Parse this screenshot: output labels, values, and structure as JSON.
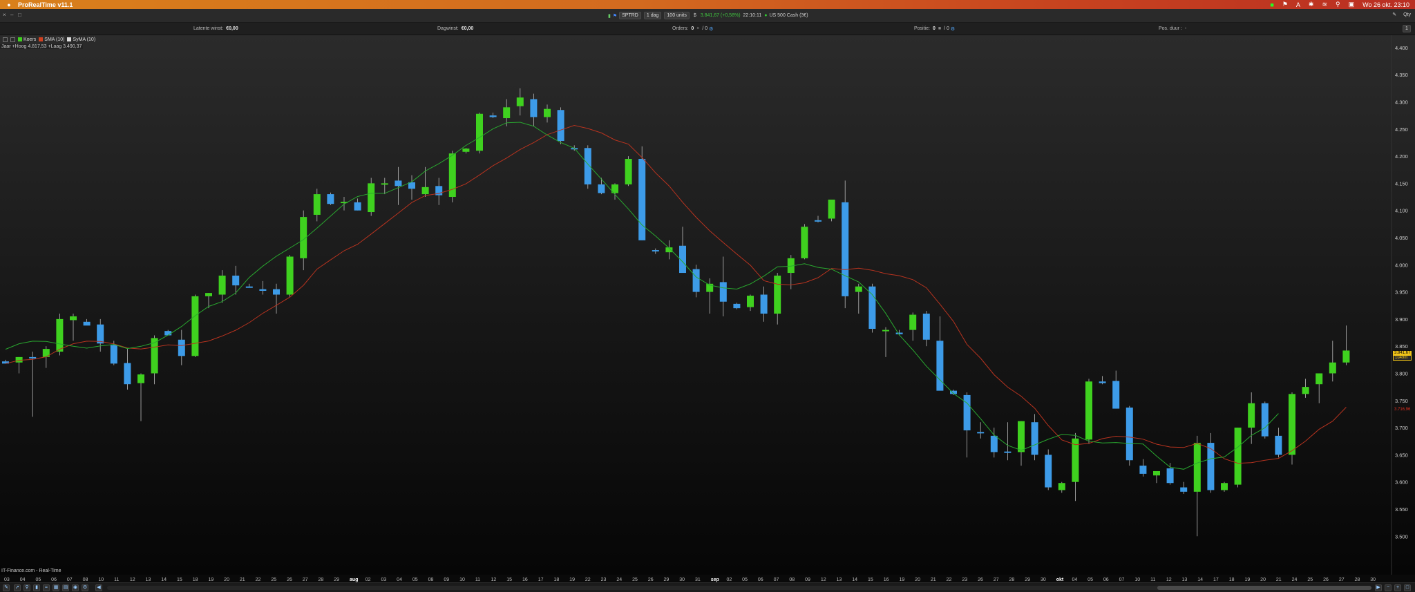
{
  "menubar": {
    "app_name": "ProRealTime v11.1",
    "clock": "Wo 26 okt. 23:10"
  },
  "toolbar": {
    "symbol": "SPTRD",
    "timeframe": "1 dag",
    "quantity": "100 units",
    "currency": "$",
    "price_change": "3.841,67 (+0,58%)",
    "time": "22:10:11",
    "instrument_name": "US 500 Cash (3€)"
  },
  "stats": {
    "latent_label": "Latente winst:",
    "latent_value": "€0,00",
    "daywin_label": "Dagwinst:",
    "daywin_value": "€0,00",
    "orders_label": "Orders:",
    "orders_value": "0",
    "orders_value2": "/ 0",
    "position_label": "Positie:",
    "position_value": "0",
    "position_value2": "/ 0",
    "posduur_label": "Pos. duur :",
    "posduur_value": "-"
  },
  "qty": {
    "label": "Qty",
    "value": "1"
  },
  "legend": {
    "koers": "Koers",
    "sma": "SMA (10)",
    "syma": "SyMA (10)"
  },
  "hilo_text": "Jaar +Hoog 4.817,53 +Laag 3.490,37",
  "footer_source": "IT-Finance.com - Real-Time",
  "price_badges": {
    "last": "3.841,67",
    "timer": "1u49m",
    "red": "3.716,96"
  },
  "colors": {
    "up": "#3fd11f",
    "down": "#3d9be8",
    "sma": "#b8331f",
    "syma": "#29a82f",
    "menubar": "#d36a1f"
  },
  "chart_data": {
    "type": "candlestick",
    "title": "",
    "ylim": [
      3480,
      4410
    ],
    "y_ticks": [
      "4.400",
      "4.350",
      "4.300",
      "4.250",
      "4.200",
      "4.150",
      "4.100",
      "4.050",
      "4.000",
      "3.950",
      "3.900",
      "3.850",
      "3.800",
      "3.750",
      "3.700",
      "3.650",
      "3.600",
      "3.550",
      "3.500"
    ],
    "x_labels": [
      "03",
      "04",
      "05",
      "06",
      "07",
      "08",
      "10",
      "11",
      "12",
      "13",
      "14",
      "15",
      "18",
      "19",
      "20",
      "21",
      "22",
      "25",
      "26",
      "27",
      "28",
      "29",
      "aug",
      "02",
      "03",
      "04",
      "05",
      "08",
      "09",
      "10",
      "11",
      "12",
      "15",
      "16",
      "17",
      "18",
      "19",
      "22",
      "23",
      "24",
      "25",
      "26",
      "29",
      "30",
      "31",
      "sep",
      "02",
      "05",
      "06",
      "07",
      "08",
      "09",
      "12",
      "13",
      "14",
      "15",
      "16",
      "19",
      "20",
      "21",
      "22",
      "23",
      "26",
      "27",
      "28",
      "29",
      "30",
      "okt",
      "04",
      "05",
      "06",
      "07",
      "10",
      "11",
      "12",
      "13",
      "14",
      "17",
      "18",
      "19",
      "20",
      "21",
      "24",
      "25",
      "26",
      "27",
      "28",
      "30"
    ],
    "month_labels": [
      "aug",
      "sep",
      "okt"
    ],
    "candles": [
      {
        "o": 3822,
        "h": 3825,
        "l": 3818,
        "c": 3818
      },
      {
        "o": 3820,
        "h": 3830,
        "l": 3800,
        "c": 3830
      },
      {
        "o": 3830,
        "h": 3840,
        "l": 3720,
        "c": 3829
      },
      {
        "o": 3830,
        "h": 3850,
        "l": 3810,
        "c": 3845
      },
      {
        "o": 3840,
        "h": 3910,
        "l": 3833,
        "c": 3900
      },
      {
        "o": 3898,
        "h": 3910,
        "l": 3860,
        "c": 3905
      },
      {
        "o": 3895,
        "h": 3900,
        "l": 3890,
        "c": 3888
      },
      {
        "o": 3890,
        "h": 3900,
        "l": 3840,
        "c": 3855
      },
      {
        "o": 3852,
        "h": 3860,
        "l": 3815,
        "c": 3818
      },
      {
        "o": 3819,
        "h": 3845,
        "l": 3770,
        "c": 3780
      },
      {
        "o": 3782,
        "h": 3800,
        "l": 3712,
        "c": 3798
      },
      {
        "o": 3800,
        "h": 3870,
        "l": 3780,
        "c": 3865
      },
      {
        "o": 3878,
        "h": 3880,
        "l": 3870,
        "c": 3870
      },
      {
        "o": 3862,
        "h": 3880,
        "l": 3815,
        "c": 3832
      },
      {
        "o": 3832,
        "h": 3945,
        "l": 3830,
        "c": 3942
      },
      {
        "o": 3942,
        "h": 3948,
        "l": 3920,
        "c": 3948
      },
      {
        "o": 3945,
        "h": 3990,
        "l": 3930,
        "c": 3980
      },
      {
        "o": 3980,
        "h": 3998,
        "l": 3945,
        "c": 3962
      },
      {
        "o": 3960,
        "h": 3965,
        "l": 3958,
        "c": 3958
      },
      {
        "o": 3955,
        "h": 3970,
        "l": 3945,
        "c": 3952
      },
      {
        "o": 3955,
        "h": 3965,
        "l": 3910,
        "c": 3945
      },
      {
        "o": 3945,
        "h": 4018,
        "l": 3940,
        "c": 4015
      },
      {
        "o": 4012,
        "h": 4100,
        "l": 3990,
        "c": 4088
      },
      {
        "o": 4092,
        "h": 4140,
        "l": 4080,
        "c": 4130
      },
      {
        "o": 4130,
        "h": 4133,
        "l": 4110,
        "c": 4112
      },
      {
        "o": 4115,
        "h": 4125,
        "l": 4100,
        "c": 4116
      },
      {
        "o": 4115,
        "h": 4122,
        "l": 4100,
        "c": 4100
      },
      {
        "o": 4097,
        "h": 4160,
        "l": 4090,
        "c": 4150
      },
      {
        "o": 4150,
        "h": 4160,
        "l": 4130,
        "c": 4150
      },
      {
        "o": 4155,
        "h": 4180,
        "l": 4110,
        "c": 4145
      },
      {
        "o": 4152,
        "h": 4165,
        "l": 4120,
        "c": 4140
      },
      {
        "o": 4130,
        "h": 4180,
        "l": 4125,
        "c": 4143
      },
      {
        "o": 4145,
        "h": 4160,
        "l": 4110,
        "c": 4128
      },
      {
        "o": 4125,
        "h": 4210,
        "l": 4115,
        "c": 4205
      },
      {
        "o": 4208,
        "h": 4215,
        "l": 4205,
        "c": 4214
      },
      {
        "o": 4210,
        "h": 4280,
        "l": 4205,
        "c": 4278
      },
      {
        "o": 4275,
        "h": 4280,
        "l": 4270,
        "c": 4272
      },
      {
        "o": 4270,
        "h": 4305,
        "l": 4255,
        "c": 4290
      },
      {
        "o": 4292,
        "h": 4325,
        "l": 4275,
        "c": 4308
      },
      {
        "o": 4305,
        "h": 4315,
        "l": 4255,
        "c": 4272
      },
      {
        "o": 4272,
        "h": 4295,
        "l": 4262,
        "c": 4287
      },
      {
        "o": 4285,
        "h": 4290,
        "l": 4222,
        "c": 4228
      },
      {
        "o": 4215,
        "h": 4220,
        "l": 4210,
        "c": 4213
      },
      {
        "o": 4215,
        "h": 4220,
        "l": 4140,
        "c": 4148
      },
      {
        "o": 4148,
        "h": 4160,
        "l": 4130,
        "c": 4132
      },
      {
        "o": 4132,
        "h": 4150,
        "l": 4120,
        "c": 4148
      },
      {
        "o": 4148,
        "h": 4200,
        "l": 4145,
        "c": 4195
      },
      {
        "o": 4195,
        "h": 4218,
        "l": 4045,
        "c": 4045
      },
      {
        "o": 4027,
        "h": 4030,
        "l": 4020,
        "c": 4025
      },
      {
        "o": 4023,
        "h": 4045,
        "l": 4010,
        "c": 4032
      },
      {
        "o": 4035,
        "h": 4070,
        "l": 3990,
        "c": 3985
      },
      {
        "o": 3992,
        "h": 4000,
        "l": 3940,
        "c": 3950
      },
      {
        "o": 3950,
        "h": 3975,
        "l": 3910,
        "c": 3965
      },
      {
        "o": 3968,
        "h": 4015,
        "l": 3905,
        "c": 3932
      },
      {
        "o": 3928,
        "h": 3930,
        "l": 3918,
        "c": 3920
      },
      {
        "o": 3922,
        "h": 3945,
        "l": 3915,
        "c": 3943
      },
      {
        "o": 3945,
        "h": 3960,
        "l": 3895,
        "c": 3910
      },
      {
        "o": 3910,
        "h": 3985,
        "l": 3890,
        "c": 3980
      },
      {
        "o": 3985,
        "h": 4018,
        "l": 3955,
        "c": 4012
      },
      {
        "o": 4012,
        "h": 4075,
        "l": 4010,
        "c": 4070
      },
      {
        "o": 4082,
        "h": 4090,
        "l": 4078,
        "c": 4080
      },
      {
        "o": 4085,
        "h": 4120,
        "l": 4080,
        "c": 4120
      },
      {
        "o": 4115,
        "h": 4155,
        "l": 3920,
        "c": 3942
      },
      {
        "o": 3950,
        "h": 3965,
        "l": 3910,
        "c": 3960
      },
      {
        "o": 3960,
        "h": 3965,
        "l": 3875,
        "c": 3882
      },
      {
        "o": 3880,
        "h": 3885,
        "l": 3830,
        "c": 3880
      },
      {
        "o": 3875,
        "h": 3880,
        "l": 3870,
        "c": 3872
      },
      {
        "o": 3880,
        "h": 3912,
        "l": 3860,
        "c": 3908
      },
      {
        "o": 3910,
        "h": 3915,
        "l": 3850,
        "c": 3862
      },
      {
        "o": 3860,
        "h": 3905,
        "l": 3770,
        "c": 3768
      },
      {
        "o": 3768,
        "h": 3770,
        "l": 3760,
        "c": 3762
      },
      {
        "o": 3760,
        "h": 3765,
        "l": 3645,
        "c": 3695
      },
      {
        "o": 3692,
        "h": 3710,
        "l": 3680,
        "c": 3690
      },
      {
        "o": 3685,
        "h": 3700,
        "l": 3645,
        "c": 3655
      },
      {
        "o": 3656,
        "h": 3710,
        "l": 3640,
        "c": 3655
      },
      {
        "o": 3655,
        "h": 3712,
        "l": 3630,
        "c": 3712
      },
      {
        "o": 3710,
        "h": 3725,
        "l": 3640,
        "c": 3650
      },
      {
        "o": 3650,
        "h": 3660,
        "l": 3585,
        "c": 3590
      },
      {
        "o": 3585,
        "h": 3600,
        "l": 3580,
        "c": 3598
      },
      {
        "o": 3600,
        "h": 3690,
        "l": 3565,
        "c": 3680
      },
      {
        "o": 3678,
        "h": 3790,
        "l": 3670,
        "c": 3785
      },
      {
        "o": 3785,
        "h": 3795,
        "l": 3780,
        "c": 3782
      },
      {
        "o": 3786,
        "h": 3805,
        "l": 3735,
        "c": 3735
      },
      {
        "o": 3737,
        "h": 3740,
        "l": 3630,
        "c": 3640
      },
      {
        "o": 3630,
        "h": 3642,
        "l": 3610,
        "c": 3615
      },
      {
        "o": 3612,
        "h": 3620,
        "l": 3598,
        "c": 3620
      },
      {
        "o": 3625,
        "h": 3635,
        "l": 3595,
        "c": 3598
      },
      {
        "o": 3590,
        "h": 3600,
        "l": 3578,
        "c": 3582
      },
      {
        "o": 3582,
        "h": 3685,
        "l": 3500,
        "c": 3672
      },
      {
        "o": 3672,
        "h": 3690,
        "l": 3580,
        "c": 3585
      },
      {
        "o": 3585,
        "h": 3600,
        "l": 3582,
        "c": 3598
      },
      {
        "o": 3595,
        "h": 3700,
        "l": 3590,
        "c": 3700
      },
      {
        "o": 3700,
        "h": 3765,
        "l": 3670,
        "c": 3745
      },
      {
        "o": 3745,
        "h": 3748,
        "l": 3680,
        "c": 3684
      },
      {
        "o": 3685,
        "h": 3700,
        "l": 3645,
        "c": 3650
      },
      {
        "o": 3650,
        "h": 3765,
        "l": 3632,
        "c": 3762
      },
      {
        "o": 3762,
        "h": 3790,
        "l": 3755,
        "c": 3775
      },
      {
        "o": 3780,
        "h": 3800,
        "l": 3745,
        "c": 3800
      },
      {
        "o": 3800,
        "h": 3860,
        "l": 3785,
        "c": 3820
      },
      {
        "o": 3820,
        "h": 3888,
        "l": 3815,
        "c": 3842
      }
    ]
  }
}
